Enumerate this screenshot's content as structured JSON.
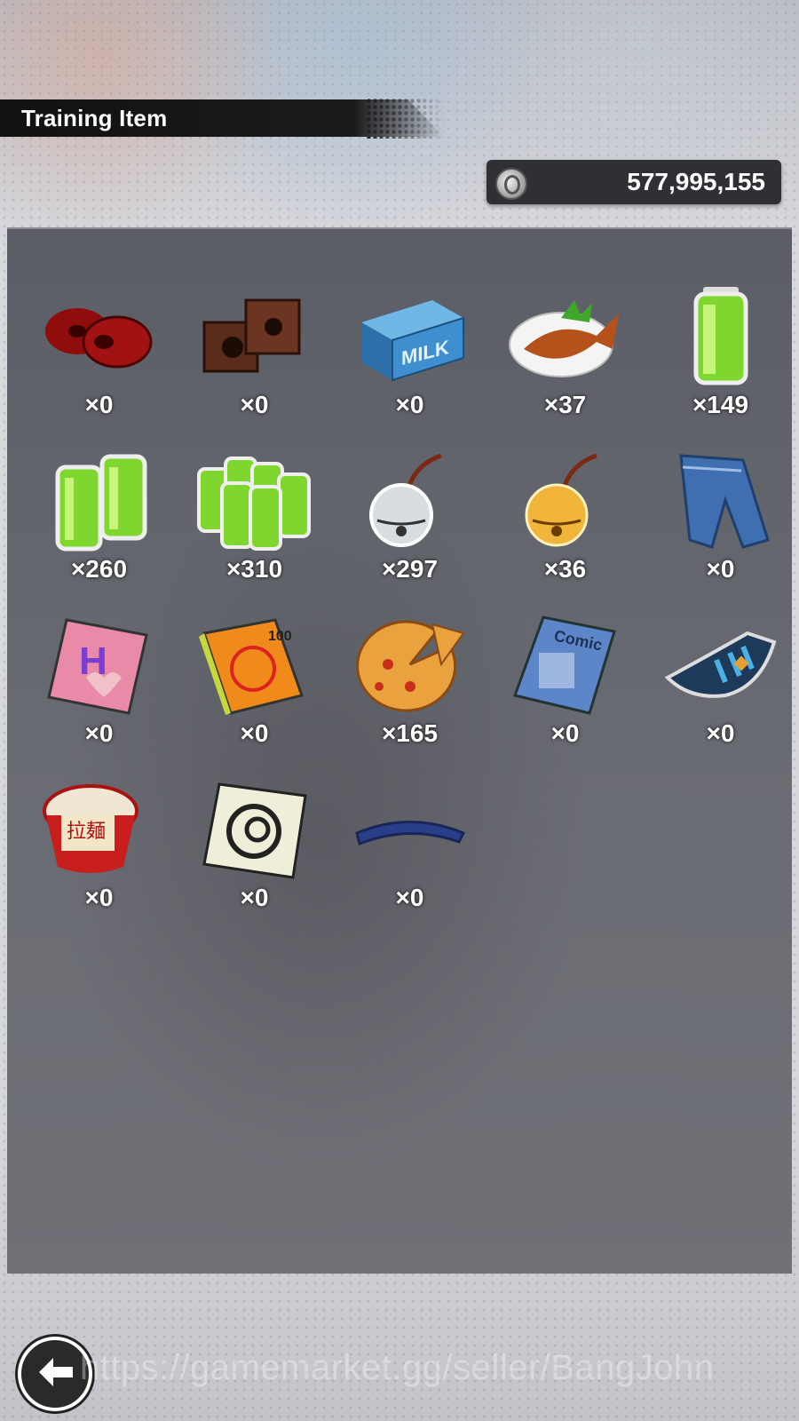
{
  "header": {
    "title": "Training Item"
  },
  "currency": {
    "icon": "coin-icon",
    "value": "577,995,155"
  },
  "items": [
    {
      "icon": "red-weights-icon",
      "count": "×0"
    },
    {
      "icon": "brick-weights-icon",
      "count": "×0"
    },
    {
      "icon": "milk-carton-icon",
      "count": "×0"
    },
    {
      "icon": "grilled-fish-icon",
      "count": "×37"
    },
    {
      "icon": "energy-battery-icon",
      "count": "×149"
    },
    {
      "icon": "battery-pair-icon",
      "count": "×260"
    },
    {
      "icon": "battery-pack-icon",
      "count": "×310"
    },
    {
      "icon": "silver-bell-icon",
      "count": "×297"
    },
    {
      "icon": "gold-bell-icon",
      "count": "×36"
    },
    {
      "icon": "jeans-icon",
      "count": "×0"
    },
    {
      "icon": "magazine-icon",
      "count": "×0"
    },
    {
      "icon": "joke-book-icon",
      "count": "×0"
    },
    {
      "icon": "pizza-icon",
      "count": "×165"
    },
    {
      "icon": "comic-book-icon",
      "count": "×0"
    },
    {
      "icon": "wristband-icon",
      "count": "×0"
    },
    {
      "icon": "instant-ramen-icon",
      "count": "×0"
    },
    {
      "icon": "scouter-card-icon",
      "count": "×0"
    },
    {
      "icon": "headband-icon",
      "count": "×0"
    }
  ],
  "footer": {
    "back_icon": "back-arrow-icon",
    "watermark": "https://gamemarket.gg/seller/BangJohn"
  }
}
